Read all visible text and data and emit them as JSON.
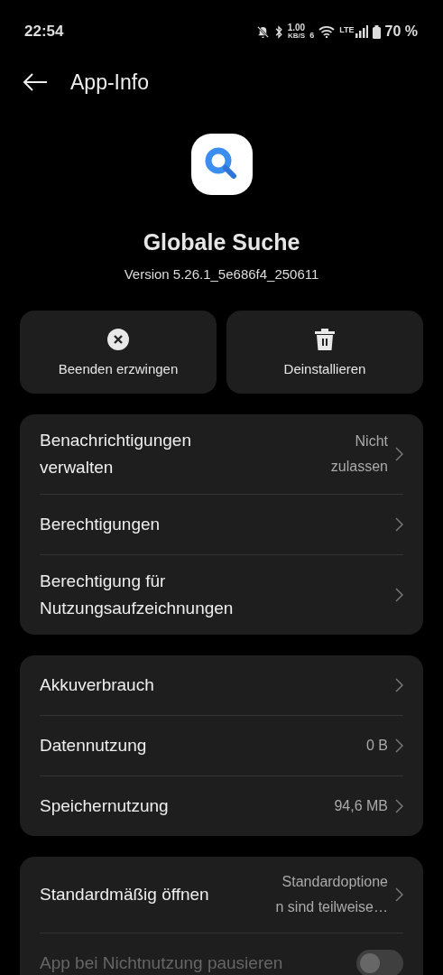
{
  "status_bar": {
    "time": "22:54",
    "speed": "1.00",
    "speed_unit": "KB/S",
    "wifi_band": "6",
    "network": "LTE",
    "battery": "70 %"
  },
  "header": {
    "title": "App-Info"
  },
  "app": {
    "name": "Globale Suche",
    "version": "Version 5.26.1_5e686f4_250611"
  },
  "actions": [
    {
      "kind": "stop",
      "label": "Beenden erzwingen"
    },
    {
      "kind": "uninstall",
      "label": "Deinstallieren"
    }
  ],
  "groups": [
    {
      "rows": [
        {
          "kind": "link",
          "label": "Benachrichtigungen verwalten",
          "value_lines": [
            "Nicht",
            "zulassen"
          ]
        },
        {
          "kind": "link",
          "label": "Berechtigungen"
        },
        {
          "kind": "link",
          "label": "Berechtigung für Nutzungsaufzeichnungen"
        }
      ]
    },
    {
      "rows": [
        {
          "kind": "link",
          "label": "Akkuverbrauch"
        },
        {
          "kind": "link",
          "label": "Datennutzung",
          "value_lines": [
            "0 B"
          ]
        },
        {
          "kind": "link",
          "label": "Speichernutzung",
          "value_lines": [
            "94,6 MB"
          ]
        }
      ]
    },
    {
      "rows": [
        {
          "kind": "link",
          "label": "Standardmäßig öffnen",
          "value_lines": [
            "Standardoptione",
            "n sind teilweise…"
          ]
        },
        {
          "kind": "toggle",
          "label": "App bei Nichtnutzung pausieren",
          "on": false,
          "disabled": true
        }
      ]
    }
  ]
}
